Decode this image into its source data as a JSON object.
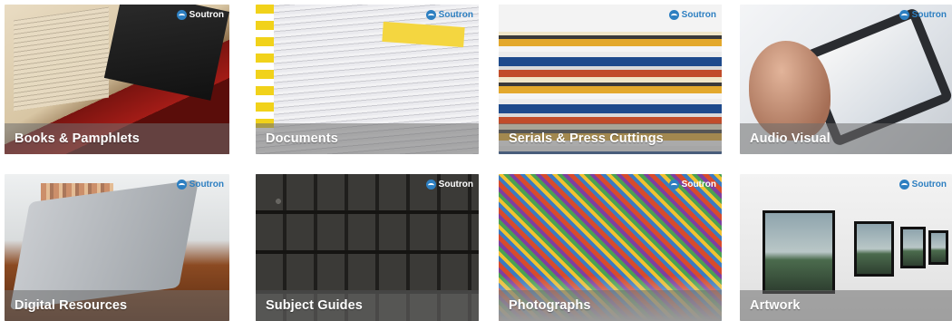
{
  "brand": {
    "name": "Soutron"
  },
  "tiles": [
    {
      "label": "Books & Pamphlets",
      "icon": "soutron-logo-icon"
    },
    {
      "label": "Documents",
      "icon": "soutron-logo-icon"
    },
    {
      "label": "Serials & Press Cuttings",
      "icon": "soutron-logo-icon"
    },
    {
      "label": "Audio Visual",
      "icon": "soutron-logo-icon"
    },
    {
      "label": "Digital Resources",
      "icon": "soutron-logo-icon"
    },
    {
      "label": "Subject Guides",
      "icon": "soutron-logo-icon"
    },
    {
      "label": "Photographs",
      "icon": "soutron-logo-icon"
    },
    {
      "label": "Artwork",
      "icon": "soutron-logo-icon"
    }
  ],
  "colors": {
    "caption_background": "#6e6e6e",
    "caption_text": "#ffffff",
    "brand_blue": "#2d7fc1"
  }
}
